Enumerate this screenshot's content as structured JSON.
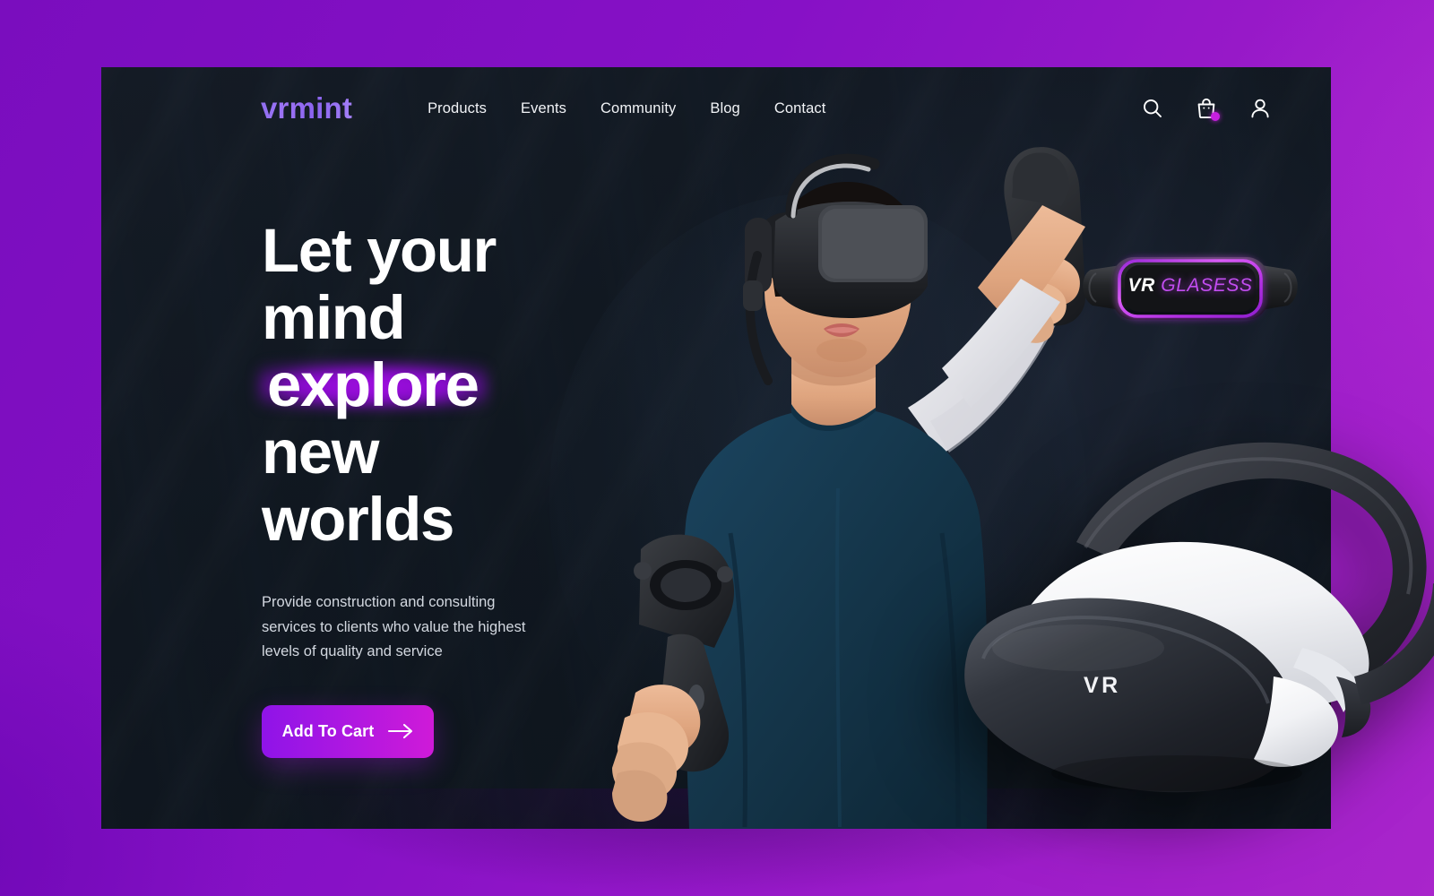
{
  "brand": {
    "logo_text": "vrmint",
    "logo_gradient_from": "#8f6ef0",
    "logo_gradient_to": "#a481f7"
  },
  "theme": {
    "page_background_purple_left": "#7a0dbe",
    "page_background_purple_right": "#a925cb",
    "card_background": "#141b25",
    "accent_magenta": "#cf1ad8",
    "accent_violet": "#8f14e8",
    "cart_badge_color": "#c71fe0",
    "glow_purple": "#a10ee0"
  },
  "nav": {
    "links": [
      {
        "label": "Products"
      },
      {
        "label": "Events"
      },
      {
        "label": "Community"
      },
      {
        "label": "Blog"
      },
      {
        "label": "Contact"
      }
    ],
    "icons": [
      {
        "name": "search-icon"
      },
      {
        "name": "shopping-bag-icon"
      },
      {
        "name": "user-account-icon"
      }
    ]
  },
  "hero": {
    "headline_lines": [
      "Let your",
      "mind",
      "explore",
      "new",
      "worlds"
    ],
    "highlighted_word": "explore",
    "paragraph": "Provide construction and consulting services to clients who value the highest levels of quality and service",
    "cta_label": "Add To Cart",
    "cta_icon": "arrow-right-icon"
  },
  "product_badge": {
    "text_primary": "VR",
    "text_secondary": "GLASESS"
  },
  "product_image": {
    "brand_mark": "VR"
  },
  "photo": {
    "alt": "woman wearing vr headset holding two controllers",
    "shirt_color": "#17384d",
    "sleeve_color": "#e9e9ee",
    "skin_color": "#e3ac89"
  }
}
